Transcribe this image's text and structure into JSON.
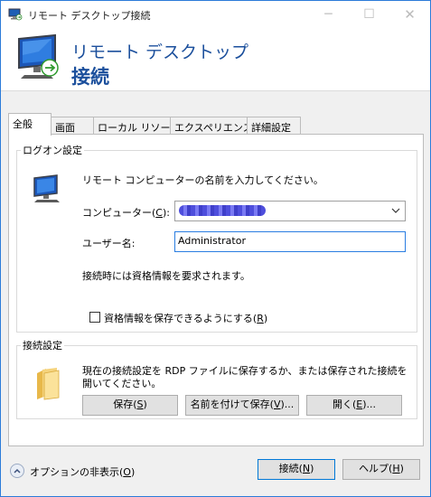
{
  "window": {
    "title": "リモート デスクトップ接続"
  },
  "banner": {
    "line1": "リモート デスクトップ",
    "line2": "接続"
  },
  "tabs": [
    {
      "label": "全般",
      "active": true
    },
    {
      "label": "画面"
    },
    {
      "label": "ローカル リソース"
    },
    {
      "label": "エクスペリエンス"
    },
    {
      "label": "詳細設定"
    }
  ],
  "logon": {
    "title": "ログオン設定",
    "intro": "リモート コンピューターの名前を入力してください。",
    "computer_label": "コンピューター(",
    "computer_key": "C",
    "computer_suffix": "):",
    "username_label": "ユーザー名:",
    "username_value": "Administrator",
    "credentials_note": "接続時には資格情報を要求されます。",
    "save_creds_label": "資格情報を保存できるようにする(",
    "save_creds_key": "R",
    "save_creds_suffix": ")",
    "save_creds_checked": false
  },
  "connection": {
    "title": "接続設定",
    "desc_line1": "現在の接続設定を RDP ファイルに保存するか、または保存された接続を",
    "desc_line2": "開いてください。",
    "save_label": "保存(",
    "save_key": "S",
    "save_suffix": ")",
    "saveas_label": "名前を付けて保存(",
    "saveas_key": "V",
    "saveas_suffix": ")...",
    "open_label": "開く(",
    "open_key": "E",
    "open_suffix": ")..."
  },
  "footer": {
    "options_label": "オプションの非表示(",
    "options_key": "O",
    "options_suffix": ")",
    "connect_label": "接続(",
    "connect_key": "N",
    "connect_suffix": ")",
    "help_label": "ヘルプ(",
    "help_key": "H",
    "help_suffix": ")"
  },
  "colors": {
    "accent": "#0078d7",
    "banner_text": "#1b4f9c"
  }
}
